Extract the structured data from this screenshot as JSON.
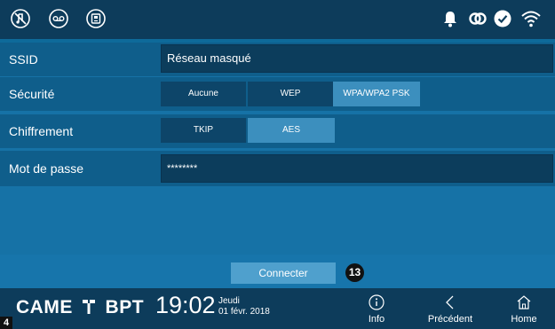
{
  "topbar": {
    "left_icons": [
      "mute-icon",
      "voicemail-icon",
      "intercom-icon"
    ],
    "right_icons": [
      "bell-icon",
      "link-icon",
      "check-icon",
      "wifi-icon"
    ]
  },
  "form": {
    "ssid": {
      "label": "SSID",
      "value": "Réseau masqué"
    },
    "security": {
      "label": "Sécurité",
      "options": [
        "Aucune",
        "WEP",
        "WPA/WPA2 PSK"
      ],
      "selected": "WPA/WPA2 PSK"
    },
    "encryption": {
      "label": "Chiffrement",
      "options": [
        "TKIP",
        "AES"
      ],
      "selected": "AES"
    },
    "password": {
      "label": "Mot de passe",
      "value": "********"
    }
  },
  "connect": {
    "label": "Connecter",
    "callout": "13"
  },
  "bottombar": {
    "brand": "CAME",
    "brand_sub": "BPT",
    "time": "19:02",
    "day": "Jeudi",
    "date": "01 févr. 2018",
    "nav": [
      {
        "label": "Info",
        "icon": "info-icon"
      },
      {
        "label": "Précédent",
        "icon": "back-icon"
      },
      {
        "label": "Home",
        "icon": "home-icon"
      }
    ]
  },
  "page_number": "4",
  "colors": {
    "background": "#0e6a9a",
    "bars": "#0d3c5b",
    "field": "#0c3d5c",
    "active": "#3c8fbe",
    "button": "#4fa0cd"
  }
}
